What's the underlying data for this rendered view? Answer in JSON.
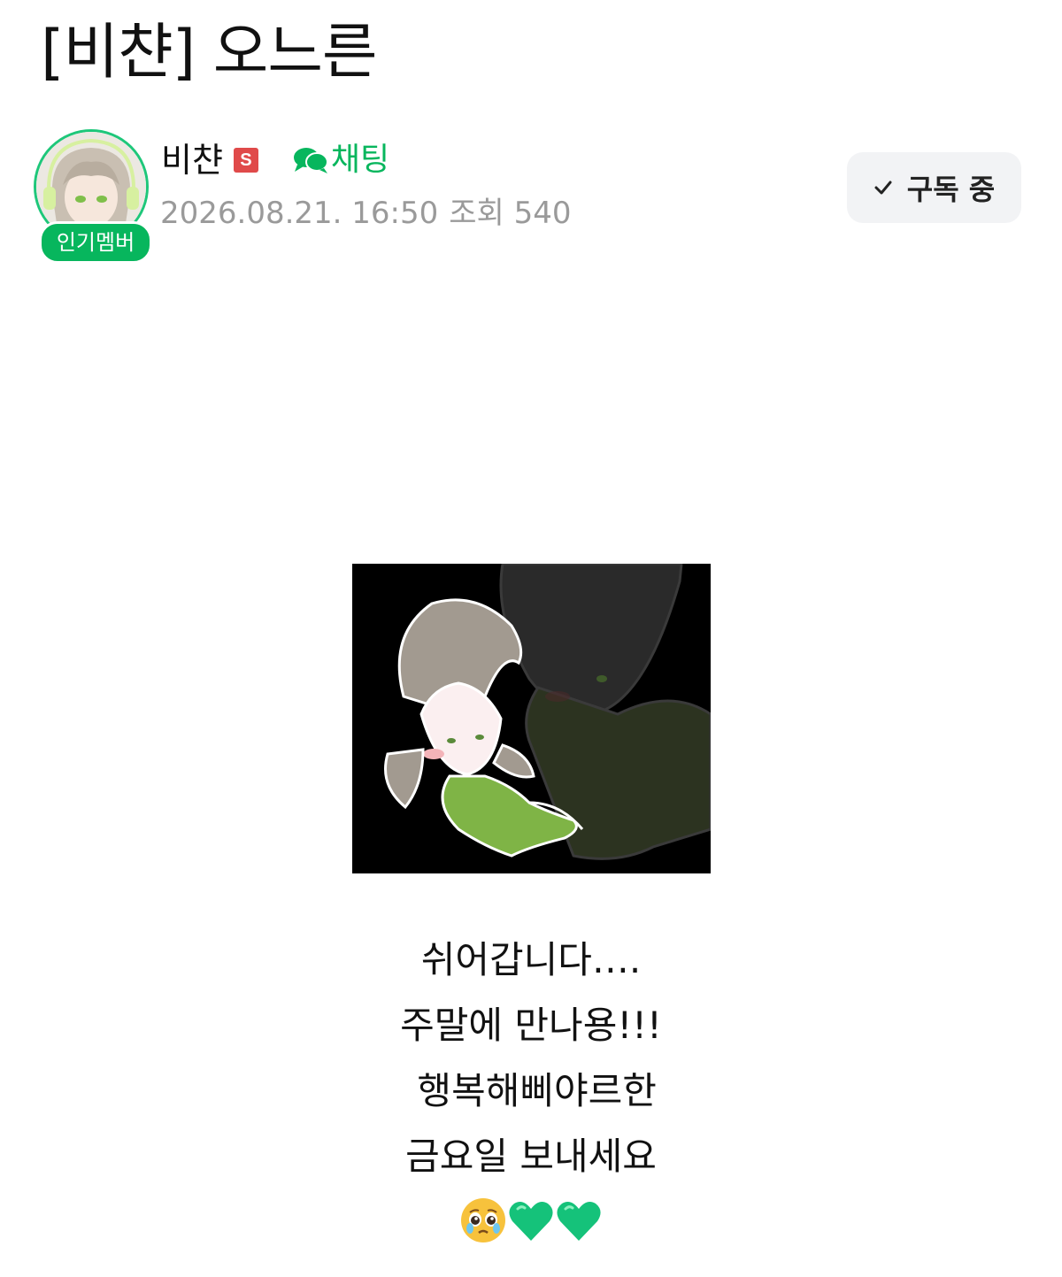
{
  "post": {
    "title": "[비챤] 오느른"
  },
  "author": {
    "name": "비챤",
    "staff_badge": "S",
    "popular_badge": "인기멤버",
    "chat_label": "채팅",
    "avatar_icon": "avatar-illustration"
  },
  "meta": {
    "date": "2026.08.21. 16:50",
    "views": "조회 540"
  },
  "subscribe": {
    "label": "구독 중",
    "icon": "check-icon"
  },
  "content": {
    "image_icon": "post-illustration",
    "lines": [
      "쉬어갑니다….",
      "주말에 만나용!!!",
      " 행복해삐야르한",
      "금요일 보내세요"
    ],
    "emojis": [
      "pleading-face-emoji",
      "green-heart-emoji",
      "green-heart-emoji"
    ]
  },
  "colors": {
    "accent_green": "#07b65d",
    "staff_red": "#e04a4a",
    "meta_gray": "#9a9a9a",
    "button_bg": "#f2f3f5"
  }
}
